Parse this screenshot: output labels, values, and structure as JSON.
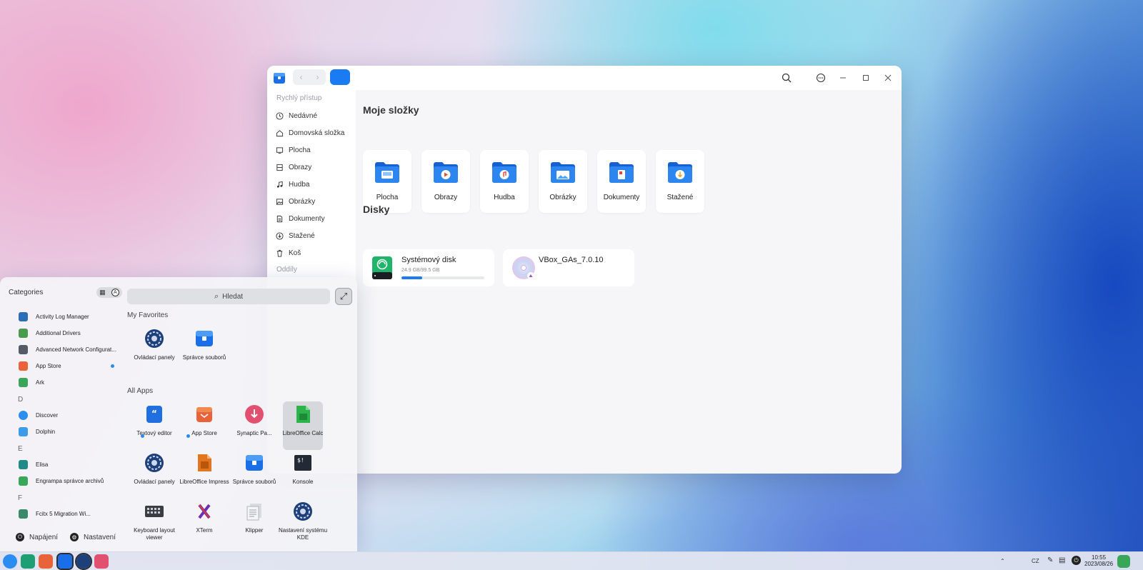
{
  "file_manager": {
    "sidebar": {
      "heading_quick": "Rychlý přístup",
      "items": [
        {
          "label": "Nedávné",
          "icon": "clock-icon"
        },
        {
          "label": "Domovská složka",
          "icon": "home-icon"
        },
        {
          "label": "Plocha",
          "icon": "desktop-icon"
        },
        {
          "label": "Obrazy",
          "icon": "film-icon"
        },
        {
          "label": "Hudba",
          "icon": "music-icon"
        },
        {
          "label": "Obrázky",
          "icon": "image-icon"
        },
        {
          "label": "Dokumenty",
          "icon": "document-icon"
        },
        {
          "label": "Stažené",
          "icon": "download-icon"
        },
        {
          "label": "Koš",
          "icon": "trash-icon"
        }
      ],
      "heading_partitions": "Oddíly"
    },
    "my_folders_title": "Moje složky",
    "folders": [
      {
        "label": "Plocha",
        "icon": "desktop-folder-icon"
      },
      {
        "label": "Obrazy",
        "icon": "video-folder-icon"
      },
      {
        "label": "Hudba",
        "icon": "music-folder-icon"
      },
      {
        "label": "Obrázky",
        "icon": "pictures-folder-icon"
      },
      {
        "label": "Dokumenty",
        "icon": "documents-folder-icon"
      },
      {
        "label": "Stažené",
        "icon": "downloads-folder-icon"
      }
    ],
    "disks_title": "Disky",
    "disks": [
      {
        "name": "Systémový disk",
        "size": "24.9 GB/99.5 GB",
        "used_fraction": 0.25
      },
      {
        "name": "VBox_GAs_7.0.10"
      }
    ]
  },
  "launcher": {
    "categories_label": "Categories",
    "view_toggle_label": "A",
    "search_placeholder": "Hledat",
    "list": [
      {
        "label": "Activity Log Manager",
        "color": "#2a6fb5"
      },
      {
        "label": "Additional Drivers",
        "color": "#4b9b4d"
      },
      {
        "label": "Advanced Network Configurat...",
        "color": "#555b66"
      },
      {
        "label": "App Store",
        "color": "#e8623a"
      },
      {
        "label": "Ark",
        "color": "#3aa65a"
      },
      {
        "label": "Discover",
        "color": "#2c8df0"
      },
      {
        "label": "Dolphin",
        "color": "#3b9be8"
      },
      {
        "label": "Elisa",
        "color": "#1f8a8a"
      },
      {
        "label": "Engrampa správce archivů",
        "color": "#3aa65a"
      },
      {
        "label": "Fcitx 5 Migration Wi...",
        "color": "#3a8a6a"
      }
    ],
    "letters": [
      "D",
      "E",
      "F"
    ],
    "favorites_title": "My Favorites",
    "favorites": [
      {
        "label": "Ovládací panely",
        "icon": "control-panel-icon"
      },
      {
        "label": "Správce souborů",
        "icon": "file-manager-icon"
      }
    ],
    "all_apps_title": "All Apps",
    "apps": [
      {
        "label": "Textový editor",
        "icon": "text-editor-icon"
      },
      {
        "label": "App Store",
        "icon": "app-store-icon"
      },
      {
        "label": "Synaptic Pa...",
        "icon": "synaptic-icon"
      },
      {
        "label": "LibreOffice Calc",
        "icon": "libreoffice-calc-icon"
      },
      {
        "label": "Ovládací panely",
        "icon": "control-panel-icon"
      },
      {
        "label": "LibreOffice Impress",
        "icon": "libreoffice-impress-icon"
      },
      {
        "label": "Správce souborů",
        "icon": "file-manager-icon"
      },
      {
        "label": "Konsole",
        "icon": "terminal-icon"
      },
      {
        "label": "Keyboard layout viewer",
        "icon": "keyboard-icon"
      },
      {
        "label": "XTerm",
        "icon": "xterm-icon"
      },
      {
        "label": "Klipper",
        "icon": "clipboard-icon"
      },
      {
        "label": "Nastavení systému KDE",
        "icon": "kde-settings-icon"
      }
    ],
    "power_label": "Napájení",
    "settings_label": "Nastavení"
  },
  "taskbar": {
    "keyboard_layout": "CZ",
    "time": "10:55",
    "date": "2023/08/26"
  }
}
